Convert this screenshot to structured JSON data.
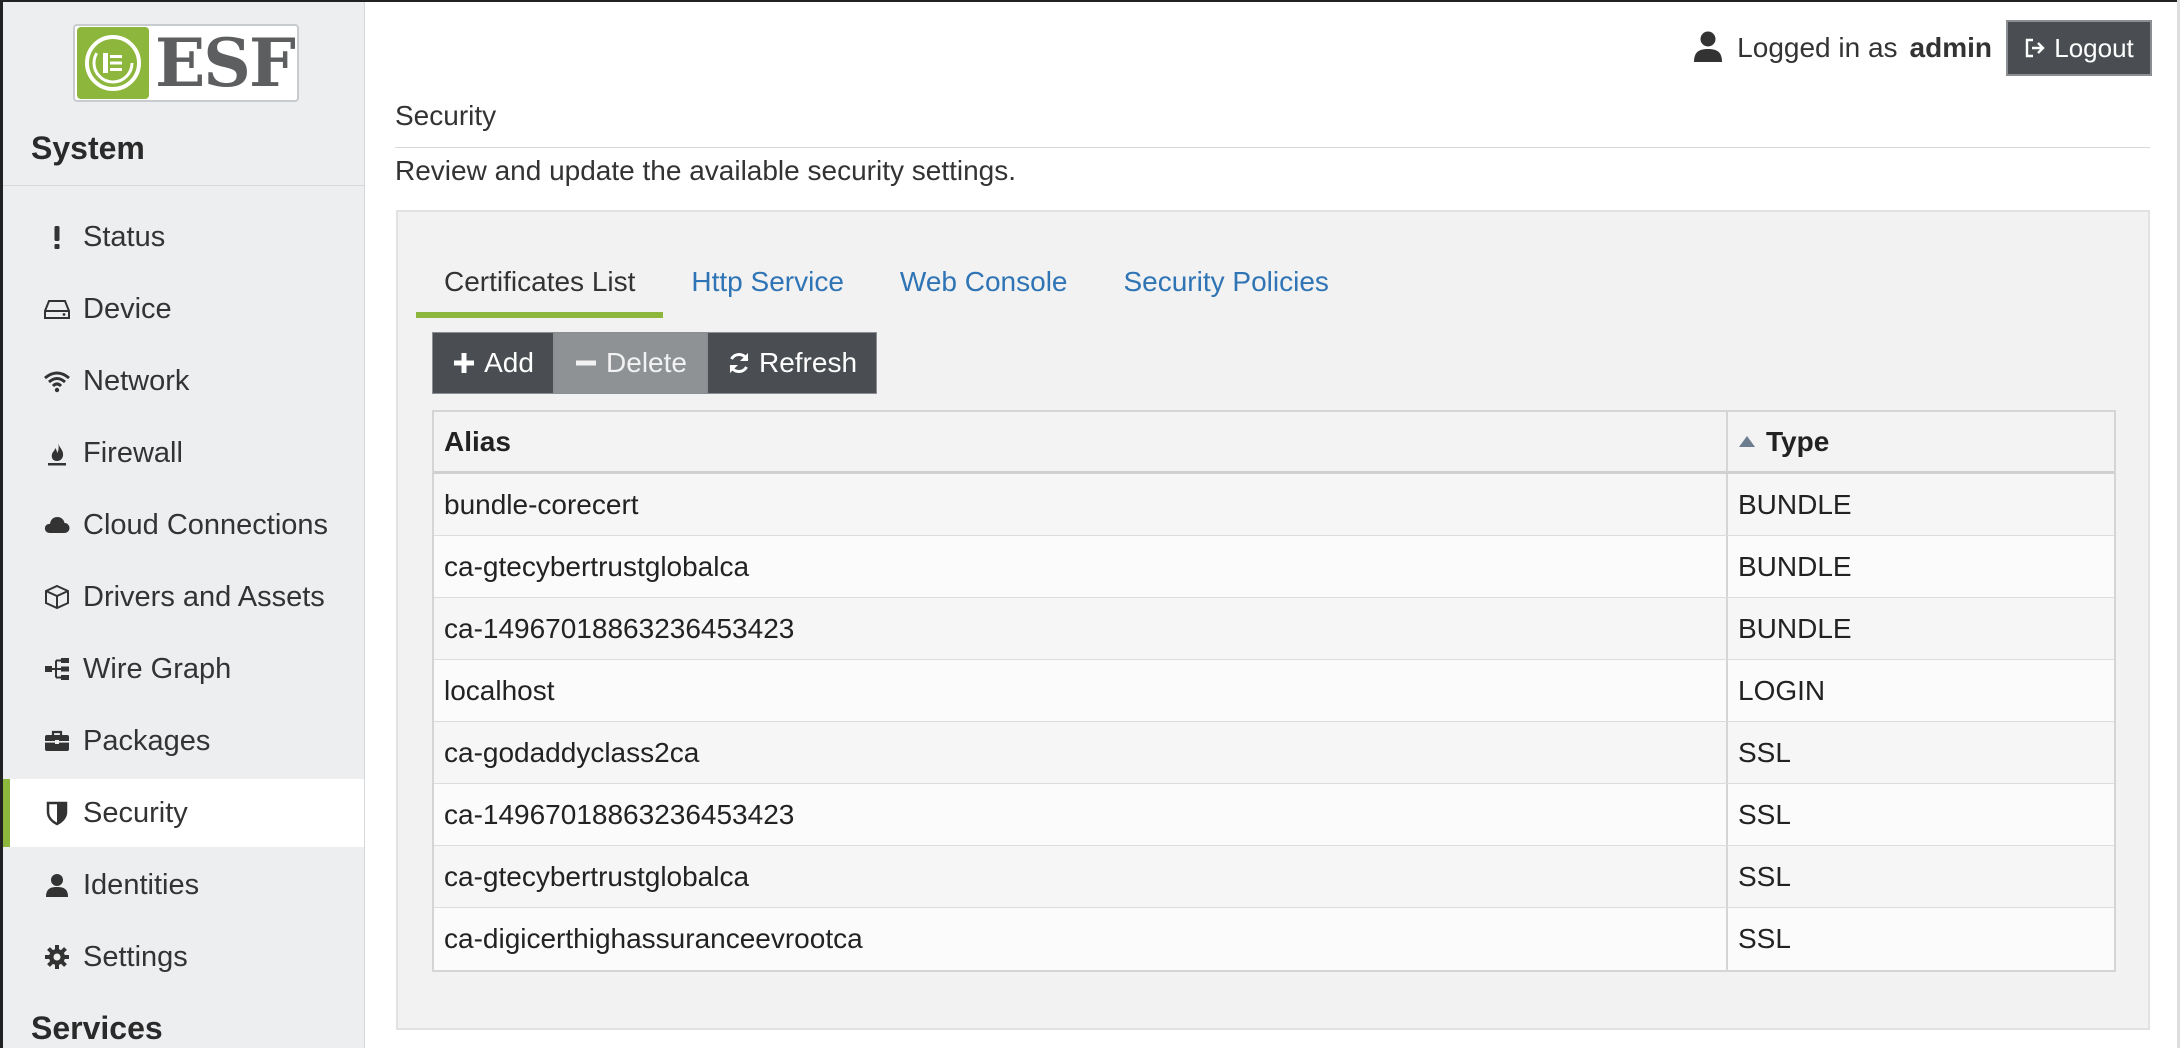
{
  "header": {
    "logged_label": "Logged in as",
    "user": "admin",
    "logout_label": "Logout"
  },
  "logo": {
    "text": "ESF",
    "accent": "#8db63c"
  },
  "sidebar": {
    "section_system": "System",
    "section_services": "Services",
    "items": [
      {
        "label": "Status",
        "icon": "exclamation-icon"
      },
      {
        "label": "Device",
        "icon": "hdd-icon"
      },
      {
        "label": "Network",
        "icon": "wifi-icon"
      },
      {
        "label": "Firewall",
        "icon": "fire-icon"
      },
      {
        "label": "Cloud Connections",
        "icon": "cloud-icon"
      },
      {
        "label": "Drivers and Assets",
        "icon": "cube-icon"
      },
      {
        "label": "Wire Graph",
        "icon": "sitemap-icon"
      },
      {
        "label": "Packages",
        "icon": "briefcase-icon"
      },
      {
        "label": "Security",
        "icon": "shield-icon",
        "active": true
      },
      {
        "label": "Identities",
        "icon": "user-icon"
      },
      {
        "label": "Settings",
        "icon": "gear-icon"
      }
    ]
  },
  "page": {
    "title": "Security",
    "description": "Review and update the available security settings."
  },
  "tabs": [
    {
      "label": "Certificates List",
      "active": true
    },
    {
      "label": "Http Service"
    },
    {
      "label": "Web Console"
    },
    {
      "label": "Security Policies"
    }
  ],
  "toolbar": {
    "add_label": "Add",
    "delete_label": "Delete",
    "refresh_label": "Refresh"
  },
  "table": {
    "columns": [
      "Alias",
      "Type"
    ],
    "sort": {
      "column": "Type",
      "direction": "ascending"
    },
    "rows": [
      {
        "alias": "bundle-corecert",
        "type": "BUNDLE"
      },
      {
        "alias": "ca-gtecybertrustglobalca",
        "type": "BUNDLE"
      },
      {
        "alias": "ca-14967018863236453423",
        "type": "BUNDLE"
      },
      {
        "alias": "localhost",
        "type": "LOGIN"
      },
      {
        "alias": "ca-godaddyclass2ca",
        "type": "SSL"
      },
      {
        "alias": "ca-14967018863236453423",
        "type": "SSL"
      },
      {
        "alias": "ca-gtecybertrustglobalca",
        "type": "SSL"
      },
      {
        "alias": "ca-digicerthighassuranceevrootca",
        "type": "SSL"
      }
    ]
  },
  "colors": {
    "accent_green": "#8db63c",
    "link_blue": "#2f74b5",
    "button_dark": "#4a4e53",
    "button_disabled": "#8e9295",
    "sidebar_bg": "#eceef0"
  }
}
